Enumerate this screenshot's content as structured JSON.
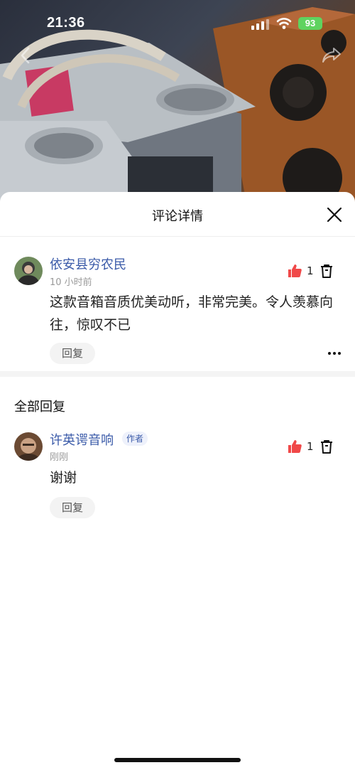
{
  "status_bar": {
    "time": "21:36",
    "battery": "93"
  },
  "header": {
    "title": "评论详情"
  },
  "main_comment": {
    "user_name": "依安县穷农民",
    "time": "10 小时前",
    "text": "这款音箱音质优美动听，非常完美。令人羡慕向往，惊叹不已",
    "likes": "1",
    "reply_label": "回复"
  },
  "replies_section": {
    "title": "全部回复"
  },
  "replies": [
    {
      "user_name": "许英谔音响",
      "badge": "作者",
      "time": "刚刚",
      "text": "谢谢",
      "likes": "1",
      "reply_label": "回复"
    }
  ],
  "colors": {
    "like": "#f04848",
    "name": "#3b5ba9",
    "battery": "#5fd35f"
  }
}
